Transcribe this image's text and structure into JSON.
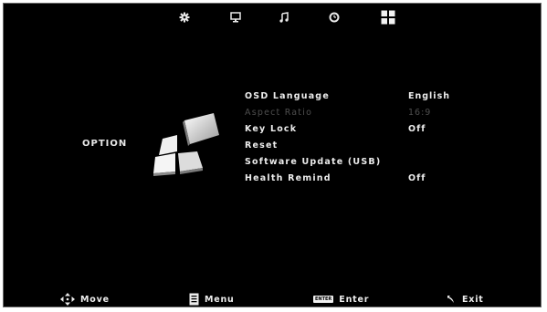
{
  "tabs": [
    {
      "icon": "gear-icon"
    },
    {
      "icon": "monitor-icon"
    },
    {
      "icon": "music-note-icon"
    },
    {
      "icon": "clock-icon"
    },
    {
      "icon": "grid-icon",
      "selected": true
    }
  ],
  "section": {
    "title": "OPTION",
    "icon": "option-blocks-icon"
  },
  "menu": {
    "items": [
      {
        "label": "OSD Language",
        "value": "English"
      },
      {
        "label": "Aspect Ratio",
        "value": "16:9",
        "disabled": true
      },
      {
        "label": "Key Lock",
        "value": "Off"
      },
      {
        "label": "Reset",
        "value": ""
      },
      {
        "label": "Software Update (USB)",
        "value": ""
      },
      {
        "label": "Health Remind",
        "value": "Off"
      }
    ]
  },
  "hints": {
    "move": {
      "label": "Move",
      "icon": "dpad-arrows-icon"
    },
    "menu": {
      "label": "Menu",
      "icon": "menu-page-icon"
    },
    "enter": {
      "label": "Enter",
      "key": "ENTER"
    },
    "exit": {
      "label": "Exit",
      "icon": "return-arrow-icon"
    }
  },
  "colors": {
    "background": "#000000",
    "text": "#ececec",
    "disabled_text": "#4e4e4e"
  }
}
